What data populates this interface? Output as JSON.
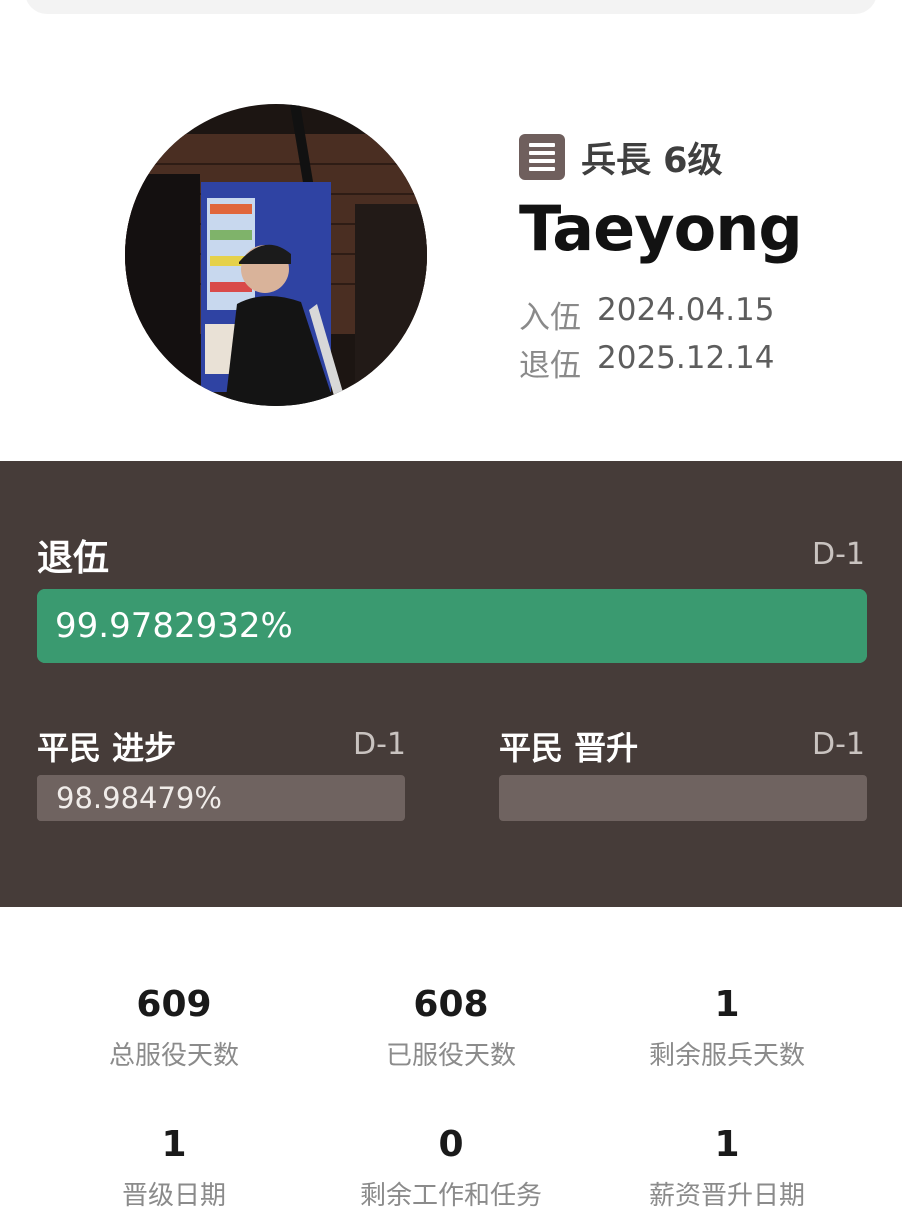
{
  "profile": {
    "rank_icon": "list-icon",
    "rank": "兵長 6级",
    "name": "Taeyong",
    "enlist_label": "入伍",
    "enlist_date": "2024.04.15",
    "discharge_label": "退伍",
    "discharge_date": "2025.12.14"
  },
  "progress": {
    "main": {
      "title": "退伍",
      "d_day": "D-1",
      "percent_text": "99.9782932%",
      "value": 0.999782932,
      "color": "#3a9a70"
    },
    "civ_progress": {
      "title": "平民 进步",
      "d_day": "D-1",
      "percent_text": "98.98479%",
      "value": 0.9898479
    },
    "civ_promotion": {
      "title": "平民 晋升",
      "d_day": "D-1"
    }
  },
  "stats": [
    {
      "value": "609",
      "label": "总服役天数"
    },
    {
      "value": "608",
      "label": "已服役天数"
    },
    {
      "value": "1",
      "label": "剩余服兵天数"
    },
    {
      "value": "1",
      "label": "晋级日期"
    },
    {
      "value": "0",
      "label": "剩余工作和任务"
    },
    {
      "value": "1",
      "label": "薪资晋升日期"
    }
  ],
  "colors": {
    "panel": "#463c39",
    "accent_green": "#3a9a70"
  }
}
